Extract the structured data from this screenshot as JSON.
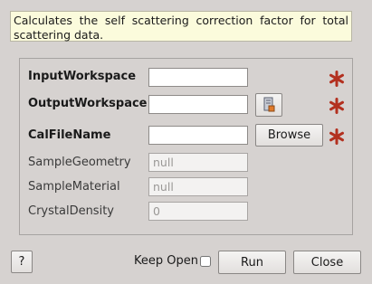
{
  "description": "Calculates the self scattering correction factor for total scattering data.",
  "fields": {
    "input_workspace": {
      "label": "InputWorkspace",
      "value": ""
    },
    "output_workspace": {
      "label": "OutputWorkspace",
      "value": ""
    },
    "cal_file_name": {
      "label": "CalFileName",
      "value": ""
    },
    "sample_geometry": {
      "label": "SampleGeometry",
      "placeholder": "null"
    },
    "sample_material": {
      "label": "SampleMaterial",
      "placeholder": "null"
    },
    "crystal_density": {
      "label": "CrystalDensity",
      "placeholder": "0"
    }
  },
  "buttons": {
    "browse": "Browse",
    "help": "?",
    "run": "Run",
    "close": "Close"
  },
  "keep_open": {
    "label": "Keep Open",
    "checked": false
  },
  "icons": {
    "required": "asterisk-icon",
    "workspace_picker": "workspace-picker-icon"
  },
  "colors": {
    "required_star": "#b3301f",
    "description_bg": "#fbfbdc",
    "window_bg": "#d6d2d0"
  }
}
